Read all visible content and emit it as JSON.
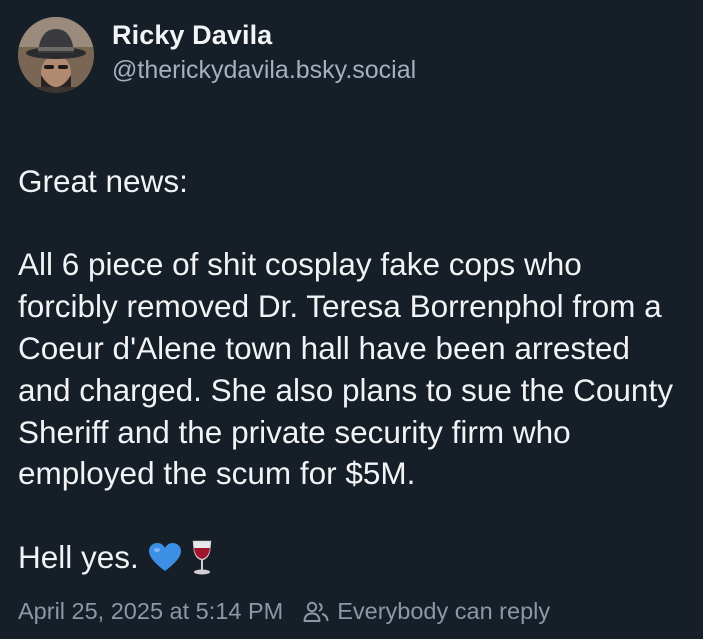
{
  "author": {
    "display_name": "Ricky Davila",
    "handle": "@therickydavila.bsky.social"
  },
  "post": {
    "greeting": "Great news:",
    "text": "All 6 piece of shit cosplay fake cops who forcibly removed Dr. Teresa Borrenphol from a Coeur d'Alene town hall have been arrested and charged. She also plans to sue the County Sheriff and the private security firm who employed the scum for $5M.",
    "closing": "Hell yes.",
    "emojis": [
      "blue-heart-icon",
      "wine-glass-icon"
    ]
  },
  "meta": {
    "timestamp": "April 25, 2025 at 5:14 PM",
    "reply_setting": "Everybody can reply",
    "reply_icon": "people-icon"
  },
  "colors": {
    "background": "#161e27",
    "text": "#f1f3f5",
    "secondary": "#a4b0bd"
  }
}
